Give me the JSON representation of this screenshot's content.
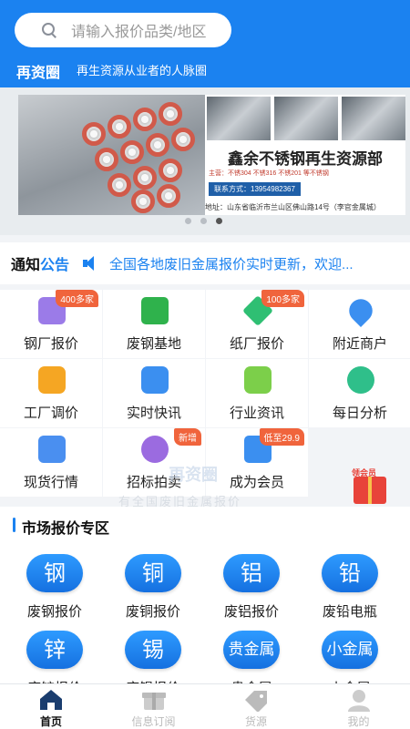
{
  "search": {
    "placeholder": "请输入报价品类/地区"
  },
  "header": {
    "brand": "再资圈",
    "tagline": "再生资源从业者的人脉圈"
  },
  "banner": {
    "title": "鑫余不锈钢再生资源部",
    "main_products": "主营：不锈304 不锈316 不锈201 等不锈钢",
    "contact": "联系方式：13954982367",
    "address": "地址：山东省临沂市兰山区佛山路14号（李官金属城）",
    "slides": 3,
    "active_slide": 3
  },
  "notice": {
    "title_a": "通知",
    "title_b": "公告",
    "text": "全国各地废旧金属报价实时更新，欢迎..."
  },
  "grid": [
    {
      "label": "钢厂报价",
      "badge": "400多家",
      "icon": "document-icon",
      "color": "#9b7be8"
    },
    {
      "label": "废钢基地",
      "badge": "",
      "icon": "flag-icon",
      "color": "#2fb24c"
    },
    {
      "label": "纸厂报价",
      "badge": "100多家",
      "icon": "layers-icon",
      "color": "#2fbf73"
    },
    {
      "label": "附近商户",
      "badge": "",
      "icon": "location-icon",
      "color": "#3b8ff0"
    },
    {
      "label": "工厂调价",
      "badge": "",
      "icon": "price-icon",
      "color": "#f5a623"
    },
    {
      "label": "实时快讯",
      "badge": "",
      "icon": "lightning-icon",
      "color": "#3b8ff0"
    },
    {
      "label": "行业资讯",
      "badge": "",
      "icon": "news-icon",
      "color": "#7ccf4a"
    },
    {
      "label": "每日分析",
      "badge": "",
      "icon": "analysis-icon",
      "color": "#2fbf8a"
    },
    {
      "label": "现货行情",
      "badge": "",
      "icon": "truck-icon",
      "color": "#4a8ff0"
    },
    {
      "label": "招标拍卖",
      "badge": "新增",
      "icon": "target-icon",
      "color": "#9b6be0"
    },
    {
      "label": "成为会员",
      "badge": "低至29.9",
      "icon": "vip-icon",
      "color": "#3b8ff0"
    }
  ],
  "gift": {
    "label": "领会员",
    "icon": "gift-icon"
  },
  "watermark": {
    "text": "再资圈",
    "sub": "有全国废旧金属报价"
  },
  "market": {
    "title": "市场报价专区",
    "items": [
      {
        "char": "钢",
        "label": "废钢报价"
      },
      {
        "char": "铜",
        "label": "废铜报价"
      },
      {
        "char": "铝",
        "label": "废铝报价"
      },
      {
        "char": "铅",
        "label": "废铅电瓶"
      },
      {
        "char": "锌",
        "label": "废锌报价"
      },
      {
        "char": "锡",
        "label": "废锡报价"
      },
      {
        "char": "贵金属",
        "label": "贵金属"
      },
      {
        "char": "小金属",
        "label": "小金属"
      }
    ]
  },
  "tabs": [
    {
      "label": "首页",
      "icon": "home-icon",
      "active": true
    },
    {
      "label": "信息订阅",
      "icon": "gift-box-icon",
      "active": false
    },
    {
      "label": "货源",
      "icon": "tag-icon",
      "active": false
    },
    {
      "label": "我的",
      "icon": "profile-icon",
      "active": false
    }
  ],
  "colors": {
    "primary": "#1b82f0",
    "badge": "#f0643c"
  }
}
